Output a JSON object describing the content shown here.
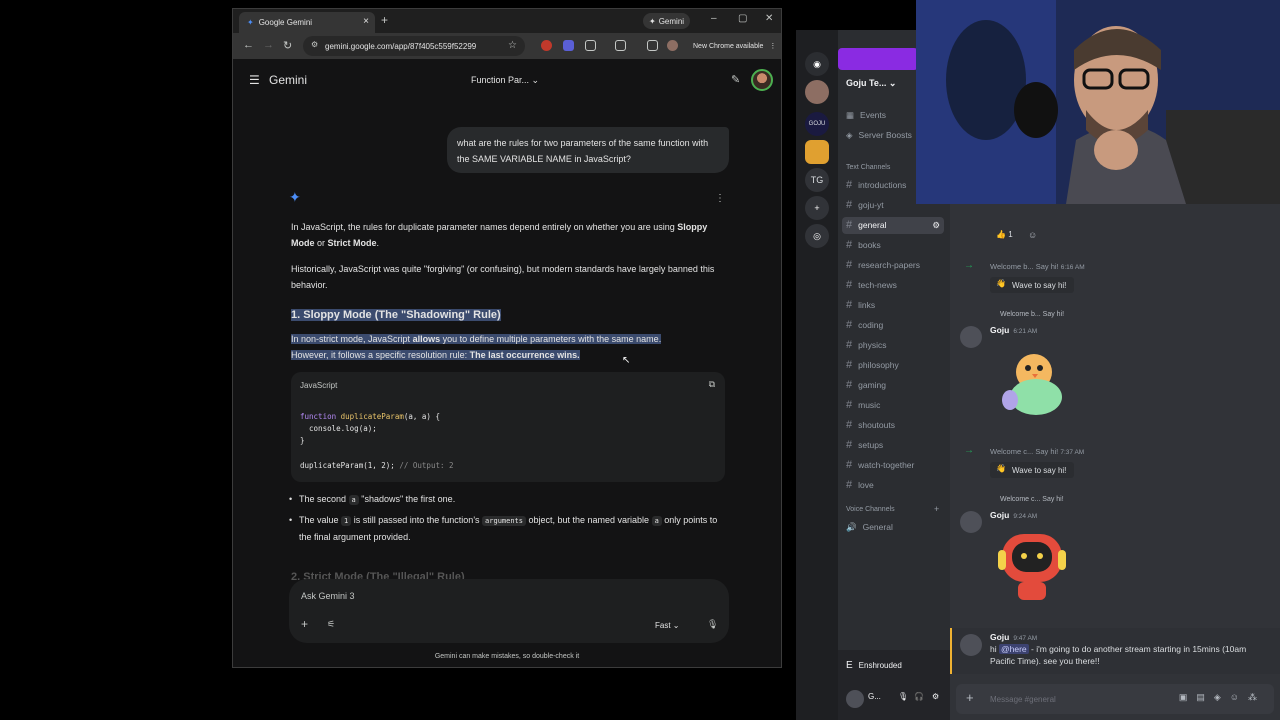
{
  "chrome": {
    "tab_title": "Google Gemini",
    "tab_close": "×",
    "new_tab": "+",
    "gemini_pill": "Gemini",
    "minimize": "–",
    "maximize": "▢",
    "close": "✕",
    "url": "gemini.google.com/app/87f405c559f52299",
    "new_chrome": "New Chrome available"
  },
  "gemini": {
    "brand": "Gemini",
    "chat_title": "Function Par...",
    "user_prompt": "what are the rules for two parameters of the same function with the SAME VARIABLE NAME in JavaScript?",
    "para1_a": "In JavaScript, the rules for duplicate parameter names depend entirely on whether you are using ",
    "para1_b": "Sloppy Mode",
    "para1_c": " or ",
    "para1_d": "Strict Mode",
    "para1_e": ".",
    "para2": "Historically, JavaScript was quite \"forgiving\" (or confusing), but modern standards have largely banned this behavior.",
    "heading1": "1. Sloppy Mode (The \"Shadowing\" Rule)",
    "para3_a": "In non-strict mode, JavaScript ",
    "para3_b": "allows",
    "para3_c": " you to define multiple parameters with the same name.",
    "para3_d": "However, it follows a specific resolution rule: ",
    "para3_e": "The last occurrence wins.",
    "code_lang": "JavaScript",
    "code_lines": {
      "l1_kw": "function",
      "l1_fn": "duplicateParam",
      "l1_rest": "(a, a) {",
      "l2": "  console.log(a);",
      "l3": "}",
      "l4_call": "duplicateParam(1, 2);",
      "l4_cm": " // Output: 2"
    },
    "bullet1_a": "The second ",
    "bullet1_code": "a",
    "bullet1_b": " \"shadows\" the first one.",
    "bullet2_a": "The value ",
    "bullet2_code1": "1",
    "bullet2_b": " is still passed into the function's ",
    "bullet2_code2": "arguments",
    "bullet2_c": " object, but the named variable ",
    "bullet2_code3": "a",
    "bullet2_d": " only points to the final argument provided.",
    "faded_heading": "2. Strict Mode (The \"Illegal\" Rule)",
    "input_placeholder": "Ask Gemini 3",
    "model_mode": "Fast",
    "disclaimer": "Gemini can make mistakes, so double-check it"
  },
  "discord": {
    "server_name": "Goju Te...",
    "guild_tg": "TG",
    "events": "Events",
    "server_boosts": "Server Boosts",
    "text_category": "Text Channels",
    "channels": [
      "introductions",
      "goju-yt",
      "general",
      "books",
      "research-papers",
      "tech-news",
      "links",
      "coding",
      "physics",
      "philosophy",
      "gaming",
      "music",
      "shoutouts",
      "setups",
      "watch-together",
      "love"
    ],
    "voice_category": "Voice Channels",
    "voice_channel": "General",
    "game_activity": "Enshrouded",
    "user_short": "G...",
    "reaction_count": "1",
    "messages": {
      "sys1_name": "Welcome b...",
      "sys1_text": "Say hi!",
      "sys1_time": "6:16 AM",
      "wave": "Wave to say hi!",
      "reply1": "Welcome b... Say hi!",
      "goju": "Goju",
      "time2": "6:21 AM",
      "sys2_name": "Welcome c...",
      "sys2_text": "Say hi!",
      "sys2_time": "7:37 AM",
      "reply2": "Welcome c... Say hi!",
      "time3": "9:24 AM",
      "time4": "9:47 AM",
      "final_a": "hi ",
      "final_mention": "@here",
      "final_b": " - i'm going to do another stream starting in 15mins (10am Pacific Time). see you there!!"
    },
    "composer_placeholder": "Message #general"
  },
  "colors": {
    "gemini_bg": "#131314",
    "gemini_accent": "#4c8df6",
    "discord_bg": "#313338",
    "discord_green": "#23a55a",
    "selection": "#3b4b6e"
  }
}
